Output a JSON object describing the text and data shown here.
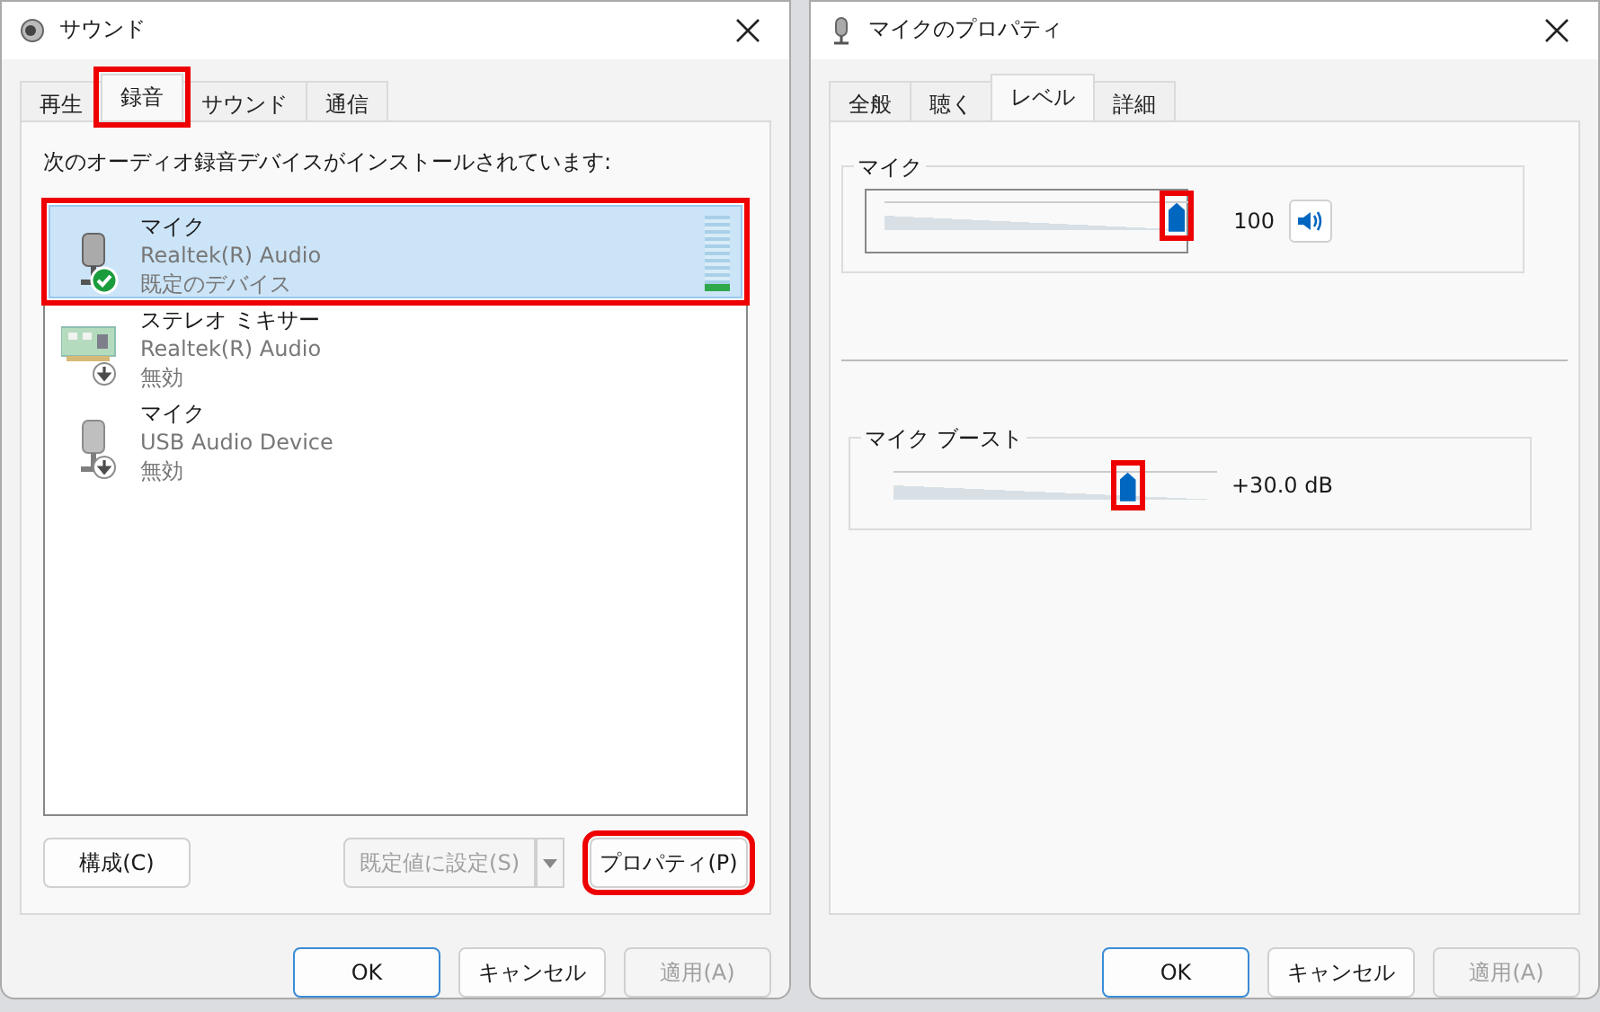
{
  "sound_dialog": {
    "title": "サウンド",
    "tabs": [
      {
        "label": "再生",
        "selected": false,
        "highlighted": false
      },
      {
        "label": "録音",
        "selected": true,
        "highlighted": true
      },
      {
        "label": "サウンド",
        "selected": false,
        "highlighted": false
      },
      {
        "label": "通信",
        "selected": false,
        "highlighted": false
      }
    ],
    "prompt": "次のオーディオ録音デバイスがインストールされています:",
    "devices": [
      {
        "kind": "microphone",
        "default": true,
        "enabled": true,
        "name": "マイク",
        "driver": "Realtek(R) Audio",
        "status": "既定のデバイス",
        "selected": true,
        "highlighted": true,
        "level": 0.1
      },
      {
        "kind": "mixer",
        "default": false,
        "enabled": false,
        "name": "ステレオ ミキサー",
        "driver": "Realtek(R) Audio",
        "status": "無効",
        "selected": false,
        "highlighted": false
      },
      {
        "kind": "microphone",
        "default": false,
        "enabled": false,
        "name": "マイク",
        "driver": "USB Audio Device",
        "status": "無効",
        "selected": false,
        "highlighted": false
      }
    ],
    "configure_button": {
      "label": "構成(C)",
      "disabled": false,
      "highlighted": false
    },
    "set_default_button": {
      "label": "既定値に設定(S)",
      "disabled": true,
      "highlighted": false
    },
    "properties_button": {
      "label": "プロパティ(P)",
      "disabled": false,
      "highlighted": true
    },
    "footer_buttons": [
      {
        "label": "OK",
        "default": true,
        "disabled": false
      },
      {
        "label": "キャンセル",
        "default": false,
        "disabled": false
      },
      {
        "label": "適用(A)",
        "default": false,
        "disabled": true
      }
    ]
  },
  "properties_dialog": {
    "title": "マイクのプロパティ",
    "tabs": [
      {
        "label": "全般",
        "selected": false
      },
      {
        "label": "聴く",
        "selected": false
      },
      {
        "label": "レベル",
        "selected": true
      },
      {
        "label": "詳細",
        "selected": false
      }
    ],
    "level_groups": [
      {
        "label": "マイク",
        "level": 1.0,
        "reading": "100",
        "framed": true,
        "speaker_button": true,
        "highlighted": true
      },
      {
        "label": "マイク ブースト",
        "level": 0.75,
        "reading": "+30.0 dB",
        "framed": false,
        "speaker_button": false,
        "highlighted": true
      }
    ],
    "footer_buttons": [
      {
        "label": "OK",
        "default": true,
        "disabled": false
      },
      {
        "label": "キャンセル",
        "default": false,
        "disabled": false
      },
      {
        "label": "適用(A)",
        "default": false,
        "disabled": true
      }
    ]
  }
}
